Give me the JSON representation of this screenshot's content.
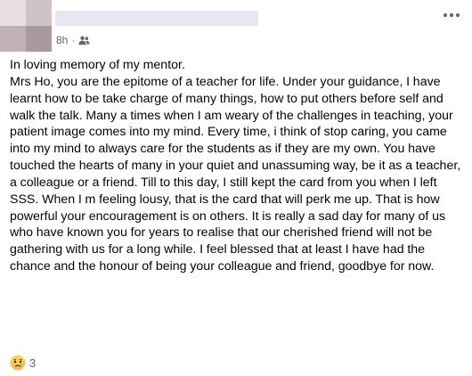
{
  "post": {
    "timestamp": "8h",
    "separator": "·",
    "audience_icon": "friends-icon",
    "more_icon": "more-options-icon",
    "text": "In loving memory of my mentor.\nMrs Ho, you are the epitome of a teacher for life. Under your guidance, I have learnt how to be take charge of many things, how to put others before self and walk the talk. Many a times when I am weary of the challenges in teaching, your patient image comes into my mind. Every time, i think of stop caring, you came into my mind to always care for the students as if they are my own. You have touched the hearts of many in your quiet and unassuming way, be it as a teacher, a colleague or a friend. Till to this day, I still kept the card from you when I left SSS. When I m feeling lousy, that is the card that will perk me up. That is how powerful your encouragement is on others. It is really a sad day for many of us who have known you for years to realise that our cherished friend will not be gathering with us for a long while. I feel blessed that at least I have had the chance and the honour of being your colleague and friend, goodbye for now."
  },
  "reactions": {
    "icon": "sad-reaction-icon",
    "count": "3"
  }
}
